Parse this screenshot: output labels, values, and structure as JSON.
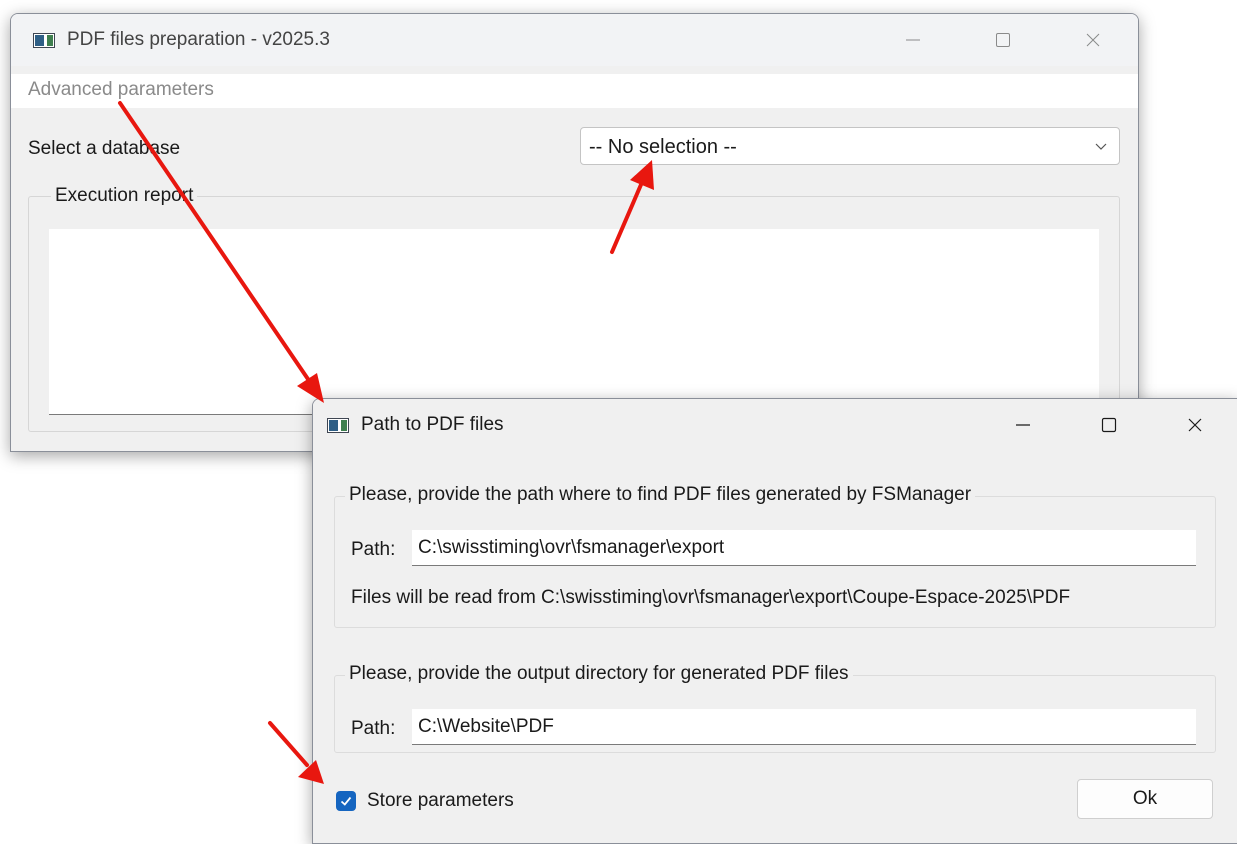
{
  "main_window": {
    "title": "PDF files preparation - v2025.3",
    "menu": {
      "advanced_parameters": "Advanced parameters"
    },
    "database_label": "Select a database",
    "database_select": {
      "selected": "-- No selection --"
    },
    "execution_report_label": "Execution report"
  },
  "dialog": {
    "title": "Path to PDF files",
    "input_group": {
      "label": "Please, provide the path where to find PDF files generated by FSManager",
      "path_label": "Path:",
      "path_value": "C:\\swisstiming\\ovr\\fsmanager\\export",
      "info": "Files will be read from C:\\swisstiming\\ovr\\fsmanager\\export\\Coupe-Espace-2025\\PDF"
    },
    "output_group": {
      "label": "Please, provide the output directory for generated PDF files",
      "path_label": "Path:",
      "path_value": "C:\\Website\\PDF"
    },
    "store_parameters": {
      "label": "Store parameters",
      "checked": true
    },
    "ok_label": "Ok"
  },
  "annotation_color": "#e8170f",
  "icons": [
    "app-icon",
    "minimize-icon",
    "maximize-icon",
    "close-icon",
    "chevron-down-icon",
    "checkmark-icon",
    "annotation-arrow"
  ]
}
